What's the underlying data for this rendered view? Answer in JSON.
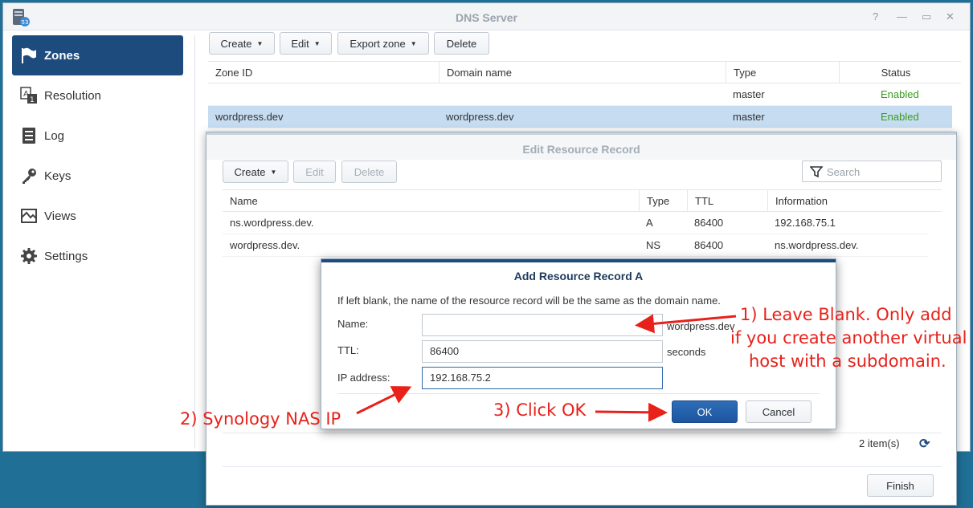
{
  "window": {
    "title": "DNS Server"
  },
  "icons": {
    "app": "dns-server-icon",
    "help": "?",
    "minimize": "—",
    "maximize": "▭",
    "close": "✕",
    "refresh": "⟳"
  },
  "sidebar": {
    "items": [
      {
        "label": "Zones",
        "icon": "flag-icon",
        "active": true
      },
      {
        "label": "Resolution",
        "icon": "resolution-icon"
      },
      {
        "label": "Log",
        "icon": "log-icon"
      },
      {
        "label": "Keys",
        "icon": "key-icon"
      },
      {
        "label": "Views",
        "icon": "map-icon"
      },
      {
        "label": "Settings",
        "icon": "gear-icon"
      }
    ]
  },
  "zones_toolbar": {
    "create": "Create",
    "edit": "Edit",
    "export": "Export zone",
    "delete": "Delete"
  },
  "zones_table": {
    "columns": [
      "Zone ID",
      "Domain name",
      "Type",
      "Status"
    ],
    "rows": [
      {
        "zone_id": "",
        "domain": "",
        "type": "master",
        "status": "Enabled"
      },
      {
        "zone_id": "wordpress.dev",
        "domain": "wordpress.dev",
        "type": "master",
        "status": "Enabled",
        "selected": true
      }
    ]
  },
  "edit_record": {
    "title": "Edit Resource Record",
    "toolbar": {
      "create": "Create",
      "edit": "Edit",
      "delete": "Delete"
    },
    "search_placeholder": "Search",
    "columns": [
      "Name",
      "Type",
      "TTL",
      "Information"
    ],
    "rows": [
      {
        "name": "ns.wordpress.dev.",
        "type": "A",
        "ttl": "86400",
        "info": "192.168.75.1"
      },
      {
        "name": "wordpress.dev.",
        "type": "NS",
        "ttl": "86400",
        "info": "ns.wordpress.dev."
      }
    ],
    "item_count": "2 item(s)",
    "finish": "Finish"
  },
  "add_dialog": {
    "title": "Add Resource Record A",
    "description": "If left blank, the name of the resource record will be the same as the domain name.",
    "name_label": "Name:",
    "name_value": "",
    "name_suffix": "wordpress.dev",
    "ttl_label": "TTL:",
    "ttl_value": "86400",
    "ttl_suffix": "seconds",
    "ip_label": "IP address:",
    "ip_value": "192.168.75.2",
    "ok": "OK",
    "cancel": "Cancel"
  },
  "annotations": {
    "a1_line1": "1) Leave Blank. Only add",
    "a1_line2": "if you create another virtual",
    "a1_line3": "host with a subdomain.",
    "a2": "2) Synology NAS IP",
    "a3": "3) Click OK",
    "color": "#e8211a"
  },
  "colors": {
    "accent": "#1d4b7e",
    "selected_row": "#c6dcf1",
    "enabled": "#3a9b1f"
  }
}
